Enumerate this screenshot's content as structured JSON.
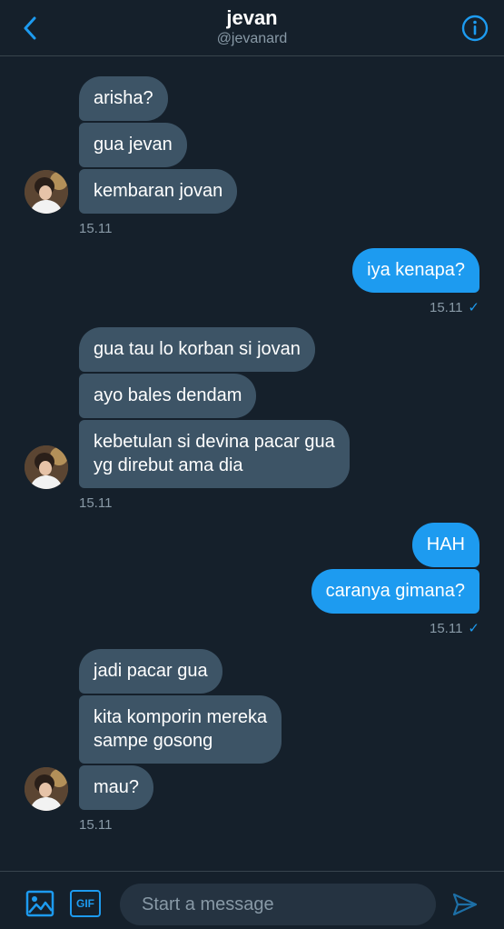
{
  "header": {
    "title": "jevan",
    "handle": "@jevanard"
  },
  "thread": [
    {
      "messages": [
        "arisha?",
        "gua jevan",
        "kembaran jovan"
      ],
      "time": "15.11"
    },
    {
      "messages": [
        "iya kenapa?"
      ],
      "time": "15.11",
      "receipt": "✓"
    },
    {
      "messages": [
        "gua tau lo korban si jovan",
        "ayo bales dendam",
        "kebetulan si devina pacar gua\nyg direbut ama dia"
      ],
      "time": "15.11"
    },
    {
      "messages": [
        "HAH",
        "caranya gimana?"
      ],
      "time": "15.11",
      "receipt": "✓"
    },
    {
      "messages": [
        "jadi pacar gua",
        "kita komporin mereka\nsampe gosong",
        "mau?"
      ],
      "time": "15.11"
    }
  ],
  "composer": {
    "placeholder": "Start a message",
    "gif_label": "GIF"
  },
  "icons": {
    "back": "chevron-left-icon",
    "info": "info-icon",
    "image": "image-icon",
    "send": "send-icon"
  },
  "colors": {
    "background": "#15202b",
    "incoming_bubble": "#3d5466",
    "outgoing_bubble": "#1d9bf0",
    "muted_text": "#8899a6"
  }
}
